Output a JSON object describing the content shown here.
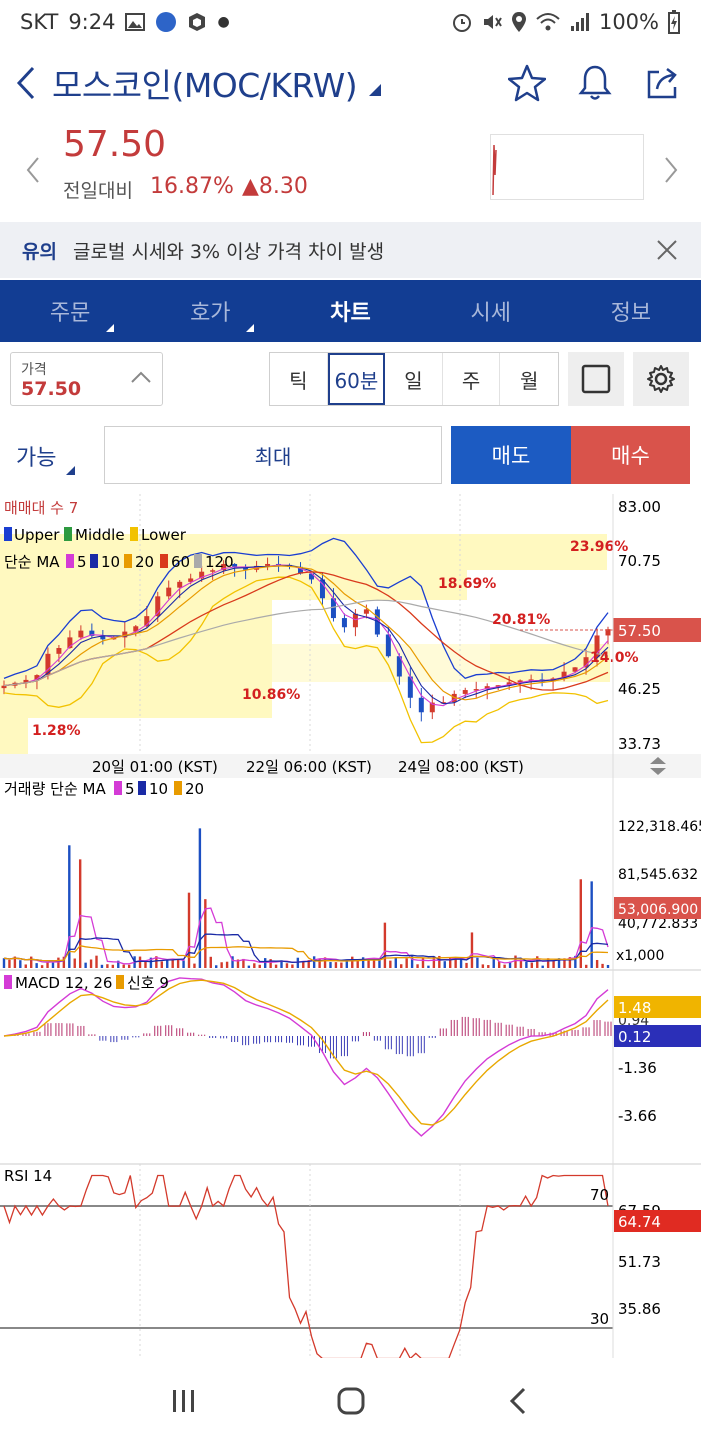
{
  "status": {
    "carrier": "SKT",
    "time": "9:24",
    "battery": "100%"
  },
  "header": {
    "title": "모스코인(MOC/KRW)"
  },
  "price": {
    "current": "57.50",
    "change_label": "전일대비",
    "change_pct": "16.87%",
    "change_amt": "▲8.30"
  },
  "notice": {
    "tag": "유의",
    "message": "글로벌 시세와 3% 이상 가격 차이 발생"
  },
  "tabs": [
    {
      "label": "주문"
    },
    {
      "label": "호가"
    },
    {
      "label": "차트"
    },
    {
      "label": "시세"
    },
    {
      "label": "정보"
    }
  ],
  "toolbar": {
    "price_label": "가격",
    "price_value": "57.50",
    "periods": [
      {
        "label": "틱"
      },
      {
        "label": "60분"
      },
      {
        "label": "일"
      },
      {
        "label": "주"
      },
      {
        "label": "월"
      }
    ],
    "active_period": "60분"
  },
  "order": {
    "avail": "가능",
    "max": "최대",
    "sell": "매도",
    "buy": "매수"
  },
  "chart_data": [
    {
      "type": "candlestick",
      "legend_top": "매매대 수 7",
      "legend_bb": [
        "Upper",
        "Middle",
        "Lower"
      ],
      "legend_ma_label": "단순 MA",
      "legend_ma": [
        "5",
        "10",
        "20",
        "60",
        "120"
      ],
      "y_ticks": [
        "83.00",
        "70.75",
        "46.25",
        "33.73"
      ],
      "current_label": "57.50",
      "x_ticks": [
        "20일 01:00 (KST)",
        "22일 06:00 (KST)",
        "24일 08:00 (KST)"
      ],
      "annotations": [
        "23.96%",
        "18.69%",
        "20.81%",
        "14.0%",
        "10.86%",
        "1.28%"
      ],
      "close": [
        45.8,
        46.4,
        47.0,
        48.0,
        52.4,
        53.6,
        55.8,
        57.2,
        56.1,
        55.4,
        55.8,
        57.0,
        58.1,
        60.2,
        64.3,
        66.1,
        67.3,
        68.0,
        69.4,
        69.7,
        71.0,
        70.4,
        69.8,
        70.6,
        71.0,
        70.8,
        70.4,
        69.0,
        67.8,
        63.9,
        59.8,
        57.9,
        60.7,
        61.6,
        56.4,
        51.9,
        47.7,
        43.3,
        40.3,
        42.3,
        42.4,
        44.1,
        44.9,
        45.1,
        45.7,
        45.9,
        46.5,
        46.9,
        47.1,
        46.7,
        47.3,
        48.7,
        49.6,
        51.7,
        56.2,
        57.5
      ]
    },
    {
      "type": "bar",
      "legend": "거래량 단순 MA",
      "legend_ma": [
        "5",
        "10",
        "20"
      ],
      "y_ticks": [
        "122,318.465",
        "81,545.632",
        "40,772.833"
      ],
      "current_label": "53,006.900",
      "unit": "x1,000"
    },
    {
      "type": "line",
      "legend": "MACD 12, 26",
      "legend_signal": "신호 9",
      "y_ticks": [
        "-1.36",
        "-3.66"
      ],
      "label_macd": "1.48",
      "label_signal": "0.12",
      "label_hidden": "0.94"
    },
    {
      "type": "line",
      "legend": "RSI 14",
      "y_ticks": [
        "70",
        "67.59",
        "51.73",
        "35.86",
        "30"
      ],
      "current_label": "64.74"
    }
  ]
}
